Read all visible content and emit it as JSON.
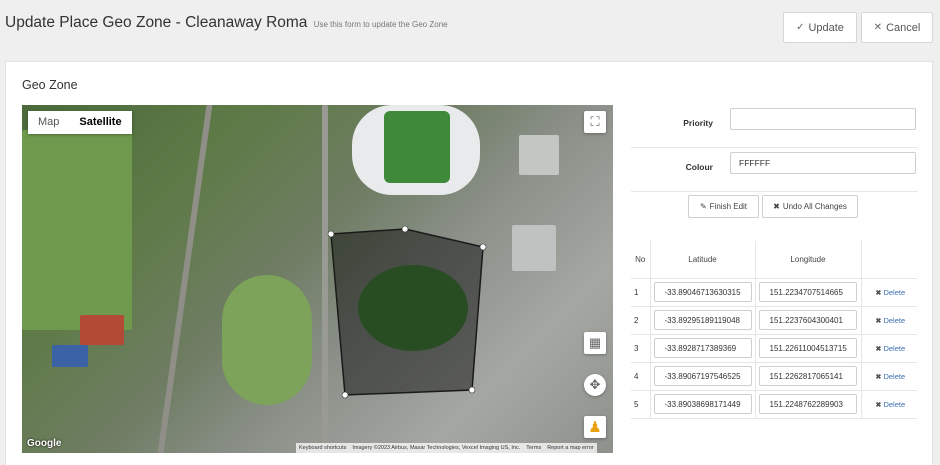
{
  "header": {
    "title": "Update Place Geo Zone - Cleanaway Roma",
    "subtitle": "Use this form to update the Geo Zone",
    "update_label": "Update",
    "cancel_label": "Cancel",
    "update_icon": "✓",
    "cancel_icon": "✕"
  },
  "section": {
    "title": "Geo Zone"
  },
  "map": {
    "tab_map": "Map",
    "tab_satellite": "Satellite",
    "selected_tab": "Satellite",
    "fullscreen_icon": "⛶",
    "grid_icon": "▦",
    "move_icon": "✥",
    "pegman_icon": "♟",
    "google_logo": "Google",
    "attribution": {
      "shortcuts": "Keyboard shortcuts",
      "imagery": "Imagery ©2023 Airbus, Maxar Technologies, Vexcel Imaging US, Inc.",
      "terms": "Terms",
      "report": "Report a map error"
    },
    "polygon_stroke": "#1a1a1a"
  },
  "form": {
    "priority_label": "Priority",
    "priority_value": "",
    "colour_label": "Colour",
    "colour_value": "FFFFFF",
    "finish_edit_label": "Finish Edit",
    "finish_edit_icon": "✎",
    "undo_label": "Undo All Changes",
    "undo_icon": "✖"
  },
  "table": {
    "col_no": "No",
    "col_lat": "Latitude",
    "col_lng": "Longitude",
    "delete_label": "Delete",
    "delete_icon": "✖",
    "rows": [
      {
        "no": "1",
        "lat": "-33.89046713630315",
        "lng": "151.2234707514665"
      },
      {
        "no": "2",
        "lat": "-33.89295189119048",
        "lng": "151.2237604300401"
      },
      {
        "no": "3",
        "lat": "-33.8928717389369",
        "lng": "151.22611004513715"
      },
      {
        "no": "4",
        "lat": "-33.89067197546525",
        "lng": "151.2262817065141"
      },
      {
        "no": "5",
        "lat": "-33.89038698171449",
        "lng": "151.2248762289903"
      }
    ]
  }
}
